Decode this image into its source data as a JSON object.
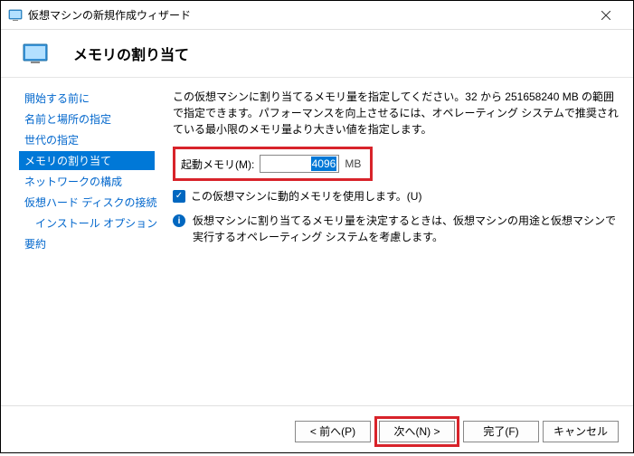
{
  "titlebar": {
    "text": "仮想マシンの新規作成ウィザード"
  },
  "header": {
    "title": "メモリの割り当て"
  },
  "sidebar": {
    "items": [
      {
        "label": "開始する前に"
      },
      {
        "label": "名前と場所の指定"
      },
      {
        "label": "世代の指定"
      },
      {
        "label": "メモリの割り当て"
      },
      {
        "label": "ネットワークの構成"
      },
      {
        "label": "仮想ハード ディスクの接続"
      },
      {
        "label": "インストール オプション"
      },
      {
        "label": "要約"
      }
    ]
  },
  "content": {
    "description": "この仮想マシンに割り当てるメモリ量を指定してください。32 から 251658240 MB の範囲で指定できます。パフォーマンスを向上させるには、オペレーティング システムで推奨されている最小限のメモリ量より大きい値を指定します。",
    "memory_label": "起動メモリ(M):",
    "memory_value": "4096",
    "memory_unit": "MB",
    "dynamic_label": "この仮想マシンに動的メモリを使用します。(U)",
    "info_text": "仮想マシンに割り当てるメモリ量を決定するときは、仮想マシンの用途と仮想マシンで実行するオペレーティング システムを考慮します。"
  },
  "footer": {
    "prev": "< 前へ(P)",
    "next": "次へ(N) >",
    "finish": "完了(F)",
    "cancel": "キャンセル"
  }
}
